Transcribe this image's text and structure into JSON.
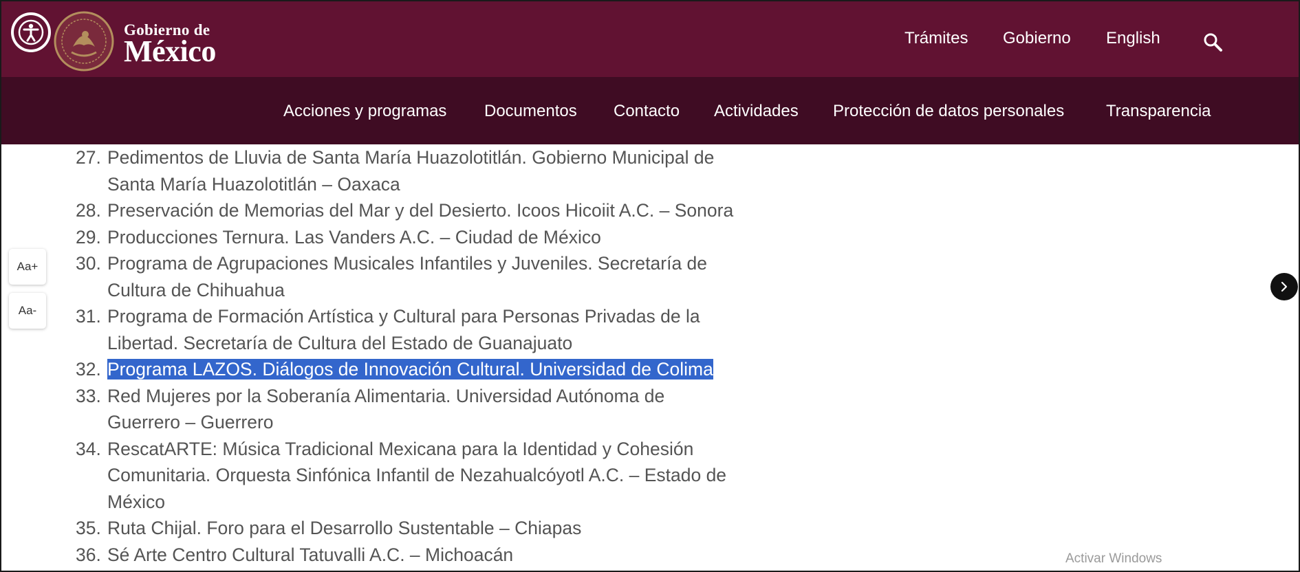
{
  "header": {
    "brand_line1": "Gobierno de",
    "brand_line2": "México",
    "nav": [
      "Trámites",
      "Gobierno",
      "English"
    ],
    "accent_color": "#611232",
    "icons": {
      "accessibility": "accessibility-icon",
      "search": "search-icon",
      "seal": "coat-of-arms-icon"
    }
  },
  "subnav": {
    "items": [
      "Acciones y programas",
      "Documentos",
      "Contacto",
      "Actividades",
      "Protección de datos personales",
      "Transparencia"
    ]
  },
  "list": {
    "items": [
      {
        "num": "27.",
        "text": "Pedimentos de Lluvia de Santa María Huazolotitlán. Gobierno Municipal de Santa María Huazolotitlán – Oaxaca"
      },
      {
        "num": "28.",
        "text": "Preservación de Memorias del Mar y del Desierto. Icoos Hicoiit A.C. – Sonora"
      },
      {
        "num": "29.",
        "text": "Producciones Ternura. Las Vanders A.C. – Ciudad de México"
      },
      {
        "num": "30.",
        "text": "Programa de Agrupaciones Musicales Infantiles y Juveniles. Secretaría de Cultura de Chihuahua"
      },
      {
        "num": "31.",
        "text": "Programa de Formación Artística y Cultural para Personas Privadas de la Libertad. Secretaría de Cultura del Estado de Guanajuato"
      },
      {
        "num": "32.",
        "text": "Programa LAZOS. Diálogos de Innovación Cultural. Universidad de Colima",
        "selected": true
      },
      {
        "num": "33.",
        "text": "Red Mujeres por la Soberanía Alimentaria. Universidad Autónoma de Guerrero – Guerrero"
      },
      {
        "num": "34.",
        "text": "RescatARTE: Música Tradicional Mexicana para la Identidad y Cohesión Comunitaria. Orquesta Sinfónica Infantil de Nezahualcóyotl A.C. – Estado de México"
      },
      {
        "num": "35.",
        "text": "Ruta Chijal. Foro para el Desarrollo Sustentable – Chiapas"
      },
      {
        "num": "36.",
        "text": "Sé Arte Centro Cultural Tatuvalli A.C. – Michoacán"
      }
    ],
    "selection_color": "#3366cc"
  },
  "font_controls": {
    "increase": "Aa+",
    "decrease": "Aa-"
  },
  "carousel": {
    "icon": "chevron-right-icon"
  },
  "watermark": "Activar Windows"
}
